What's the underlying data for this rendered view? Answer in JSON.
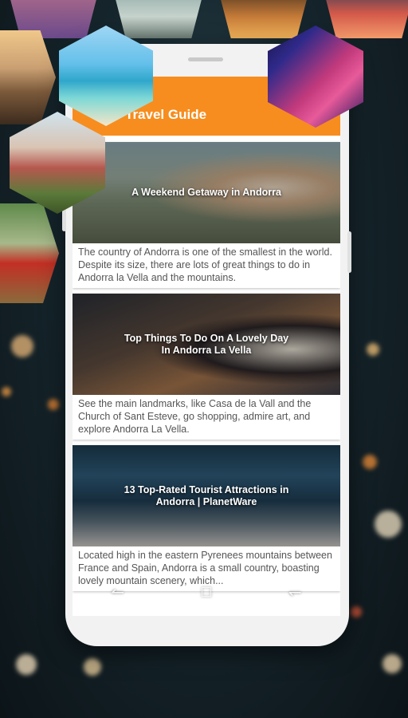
{
  "app": {
    "title": "Travel Guide",
    "accent_color": "#f78d1e"
  },
  "cards": [
    {
      "title": "A Weekend Getaway in Andorra",
      "description": "The country of Andorra is one of the smallest in the world. Despite its size, there are lots of great things to do in Andorra la Vella and the mountains."
    },
    {
      "title": "Top Things To Do On A Lovely Day In Andorra La Vella",
      "description": "See the main landmarks, like Casa de la Vall and the Church of Sant Esteve, go shopping, admire art, and explore Andorra La Vella."
    },
    {
      "title": "13 Top-Rated Tourist Attractions in Andorra | PlanetWare",
      "description": "Located high in the eastern Pyrenees mountains between France and Spain, Andorra is a small country, boasting lovely mountain scenery, which..."
    }
  ],
  "nav": {
    "back_icon": "back-icon",
    "home_icon": "home-icon",
    "recents_icon": "recents-icon"
  }
}
